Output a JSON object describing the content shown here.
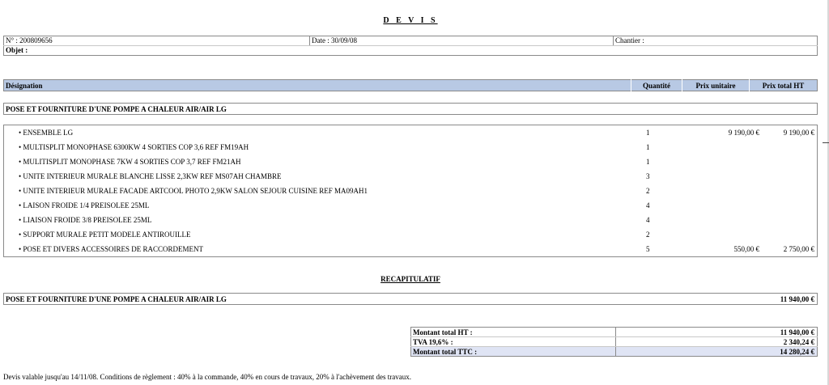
{
  "document": {
    "title": "D E V I S",
    "info": {
      "number": "N° : 200809656",
      "date": "Date : 30/09/08",
      "site": "Chantier :",
      "object": "Objet :"
    },
    "columns": {
      "designation": "Désignation",
      "quantity": "Quantité",
      "unit_price": "Prix unitaire",
      "total_price": "Prix total HT"
    },
    "section_title": "POSE ET FOURNITURE D'UNE POMPE A CHALEUR AIR/AIR LG",
    "lines": [
      {
        "designation": "• ENSEMBLE LG",
        "qty": "1",
        "unit": "9 190,00 €",
        "total": "9 190,00 €"
      },
      {
        "designation": "• MULTISPLIT MONOPHASE 6300KW 4 SORTIES COP 3,6 REF FM19AH",
        "qty": "1",
        "unit": "",
        "total": ""
      },
      {
        "designation": "• MULITISPLIT MONOPHASE 7KW 4 SORTIES COP 3,7 REF FM21AH",
        "qty": "1",
        "unit": "",
        "total": ""
      },
      {
        "designation": "• UNITE INTERIEUR MURALE BLANCHE LISSE 2,3KW REF MS07AH CHAMBRE",
        "qty": "3",
        "unit": "",
        "total": ""
      },
      {
        "designation": "• UNITE INTERIEUR MURALE FACADE ARTCOOL PHOTO 2,9KW SALON SEJOUR CUISINE REF MA09AH1",
        "qty": "2",
        "unit": "",
        "total": ""
      },
      {
        "designation": "• LAISON FROIDE 1/4 PREISOLEE 25ML",
        "qty": "4",
        "unit": "",
        "total": ""
      },
      {
        "designation": "• LIAISON FROIDE 3/8 PREISOLEE 25ML",
        "qty": "4",
        "unit": "",
        "total": ""
      },
      {
        "designation": "• SUPPORT MURALE PETIT MODELE ANTIROUILLE",
        "qty": "2",
        "unit": "",
        "total": ""
      },
      {
        "designation": "• POSE ET DIVERS ACCESSOIRES DE RACCORDEMENT",
        "qty": "5",
        "unit": "550,00 €",
        "total": "2 750,00 €"
      }
    ],
    "recap_title": "RECAPITULATIF",
    "recap": {
      "label": "POSE ET FOURNITURE D'UNE POMPE A CHALEUR AIR/AIR LG",
      "value": "11 940,00 €"
    },
    "totals": {
      "ht_label": "Montant total HT :",
      "ht_value": "11 940,00 €",
      "tva_label": "TVA 19,6% :",
      "tva_value": "2 340,24 €",
      "ttc_label": "Montant total TTC :",
      "ttc_value": "14 280,24 €"
    },
    "footer": "Devis valable jusqu'au 14/11/08. Conditions de règlement : 40% à la commande, 40% en cours de travaux, 20% à l'achèvement des travaux."
  },
  "colors": {
    "header_band": "#b8c9e4",
    "ttc_band": "#dfe4f4",
    "border": "#8a8a8a"
  }
}
